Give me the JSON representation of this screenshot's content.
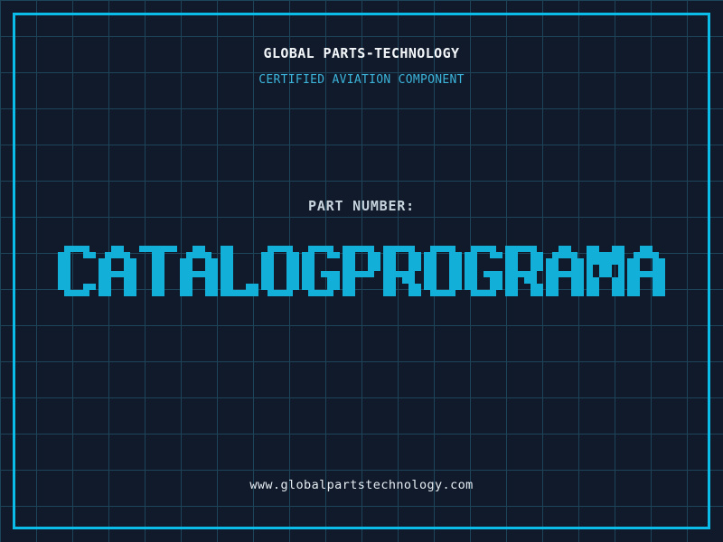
{
  "header": {
    "company": "GLOBAL PARTS-TECHNOLOGY",
    "certification": "CERTIFIED AVIATION COMPONENT"
  },
  "part": {
    "label": "PART NUMBER:",
    "number": "CATALOGPROGRAMA"
  },
  "footer": {
    "website": "www.globalpartstechnology.com"
  },
  "colors": {
    "background": "#101a2b",
    "grid_line": "#1e4459",
    "frame": "#0bbbe8",
    "part_number": "#12b0d8",
    "certification": "#3cb4da",
    "company": "#f4f7f9",
    "label": "#c6d3dc",
    "website": "#e6edf2"
  }
}
